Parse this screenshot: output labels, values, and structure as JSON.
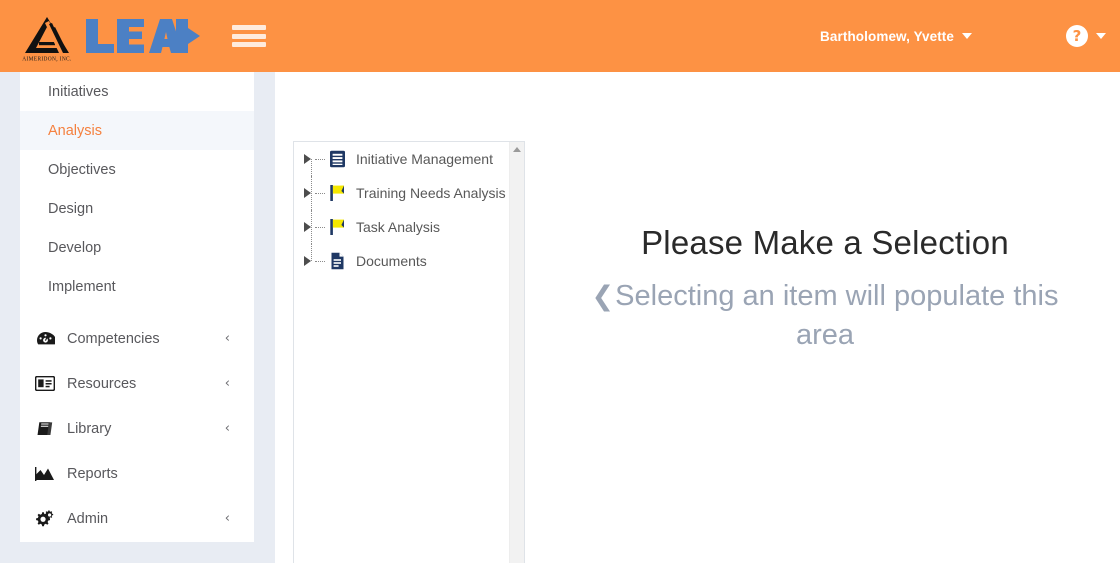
{
  "header": {
    "logo_company": "AIMERIDON, INC.",
    "logo_wordmark": "LEAD",
    "menu_icon": "hamburger-icon",
    "user_name": "Bartholomew, Yvette",
    "help_icon": "question-mark-icon",
    "brand_color": "#fd9244",
    "logo_blue": "#4c80c4"
  },
  "sidebar": {
    "sub_items": [
      {
        "label": "Initiatives",
        "active": false
      },
      {
        "label": "Analysis",
        "active": true
      },
      {
        "label": "Objectives",
        "active": false
      },
      {
        "label": "Design",
        "active": false
      },
      {
        "label": "Develop",
        "active": false
      },
      {
        "label": "Implement",
        "active": false
      }
    ],
    "main_items": [
      {
        "label": "Competencies",
        "icon": "tachometer-icon",
        "chevron": "‹"
      },
      {
        "label": "Resources",
        "icon": "id-card-icon",
        "chevron": "‹"
      },
      {
        "label": "Library",
        "icon": "book-icon",
        "chevron": "‹"
      },
      {
        "label": "Reports",
        "icon": "area-chart-icon",
        "chevron": ""
      },
      {
        "label": "Admin",
        "icon": "cogs-icon",
        "chevron": "‹"
      }
    ],
    "active_color": "#f5813f"
  },
  "tree": {
    "nodes": [
      {
        "label": "Initiative Management",
        "icon": "list-document-icon"
      },
      {
        "label": "Training Needs Analysis ((",
        "icon": "yellow-flag-icon"
      },
      {
        "label": "Task Analysis",
        "icon": "yellow-flag-icon"
      },
      {
        "label": "Documents",
        "icon": "file-document-icon"
      }
    ],
    "scroll_up_icon": "scroll-up-arrow"
  },
  "placeholder": {
    "title": "Please Make a Selection",
    "back_chevron": "❮",
    "subtitle": "Selecting an item will populate this area"
  }
}
